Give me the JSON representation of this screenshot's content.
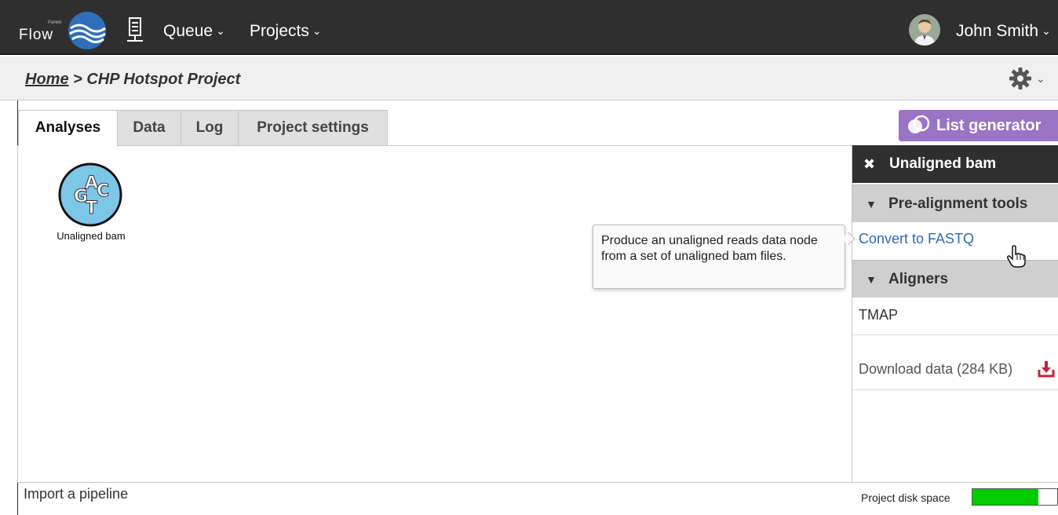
{
  "nav": {
    "brand_small": "Partek",
    "brand_name": "Flow",
    "queue_label": "Queue",
    "projects_label": "Projects",
    "user_name": "John Smith",
    "chevron": "⌄"
  },
  "breadcrumb": {
    "home": "Home",
    "separator": " > ",
    "current": "CHP Hotspot Project"
  },
  "tabs": [
    {
      "label": "Analyses",
      "active": true
    },
    {
      "label": "Data",
      "active": false
    },
    {
      "label": "Log",
      "active": false
    },
    {
      "label": "Project settings",
      "active": false
    }
  ],
  "list_generator": {
    "label": "List generator",
    "color": "#9b74c6"
  },
  "canvas": {
    "node": {
      "label": "Unaligned bam",
      "icon": "dna-acgt-icon",
      "letters": "ACGT",
      "color": "#7cc6e8"
    },
    "tooltip": "Produce an unaligned reads data node from a set of unaligned bam files."
  },
  "panel": {
    "close_glyph": "✖",
    "title": "Unaligned bam",
    "sections": [
      {
        "label": "Pre-alignment tools",
        "items": [
          "Convert to FASTQ"
        ]
      },
      {
        "label": "Aligners",
        "items": [
          "TMAP"
        ]
      }
    ],
    "download_label": "Download data (284 KB)",
    "expand_glyph": "▼"
  },
  "footer": {
    "import_label": "Import a pipeline",
    "disk_label": "Project disk space",
    "disk_usage_fraction": 0.78,
    "disk_color": "#00cc00"
  }
}
